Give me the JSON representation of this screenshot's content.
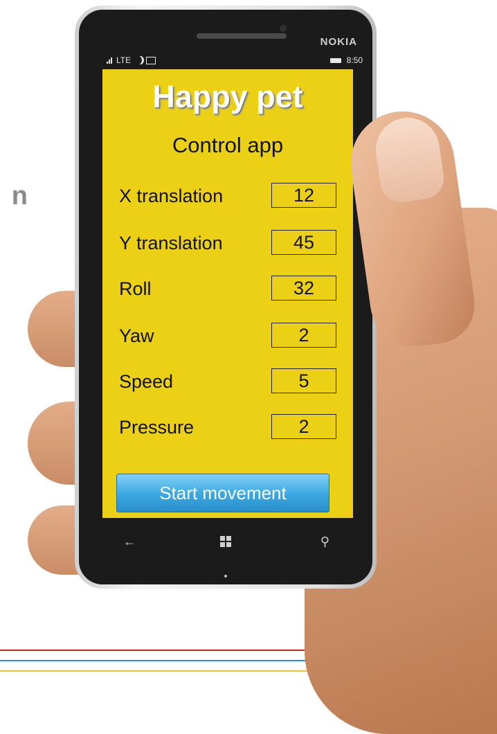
{
  "background": {
    "slide_fragment": "n",
    "stripe_colors": [
      "#d9231d",
      "#2a8fd0",
      "#f3bf2a"
    ]
  },
  "phone": {
    "brand": "NOKIA",
    "status": {
      "network": "LTE",
      "time": "8:50",
      "icons": [
        "signal-icon",
        "moon-icon",
        "message-icon",
        "battery-icon"
      ]
    },
    "nav": {
      "back_icon": "back-arrow-icon",
      "home_icon": "windows-icon",
      "search_icon": "search-icon"
    }
  },
  "app": {
    "title": "Happy pet",
    "subtitle": "Control app",
    "background_color": "#ebd016",
    "fields": [
      {
        "label": "X translation",
        "value": "12"
      },
      {
        "label": "Y translation",
        "value": "45"
      },
      {
        "label": "Roll",
        "value": "32"
      },
      {
        "label": "Yaw",
        "value": "2"
      },
      {
        "label": "Speed",
        "value": "5"
      },
      {
        "label": "Pressure",
        "value": "2"
      }
    ],
    "start_button_label": "Start movement",
    "start_button_color": "#3aa7e0"
  }
}
